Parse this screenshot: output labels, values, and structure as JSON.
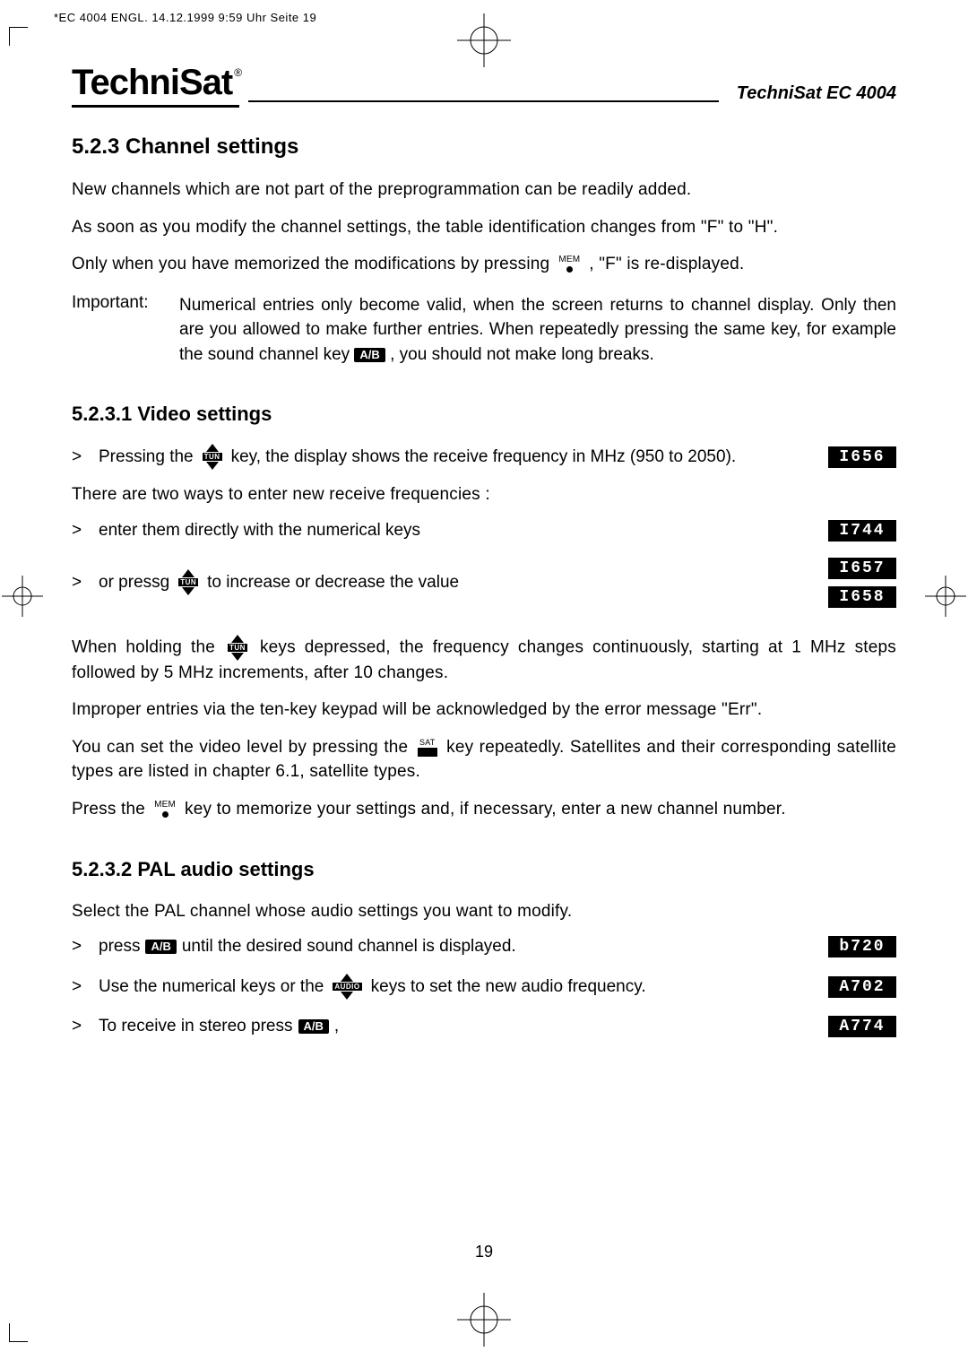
{
  "print_header": "*EC 4004 ENGL.  14.12.1999 9:59 Uhr  Seite 19",
  "logo_text": "TechniSat",
  "model": "TechniSat EC 4004",
  "sec_523_title": "5.2.3 Channel settings",
  "p_new_channels": "New channels which are not part of the preprogrammation can be readily added.",
  "p_modify": "As soon as you modify the channel settings, the table identification changes from \"F\" to \"H\".",
  "p_only_when_a": "Only when you have memorized the modifications by pressing",
  "p_only_when_b": ", \"F\" is re-displayed.",
  "important_label": "Important:",
  "important_a": "Numerical entries only become valid, when the screen returns to channel display. Only then are you allowed to make further entries. When repeatedly pressing the same key, for example the sound channel key",
  "important_b": ", you should not make long breaks.",
  "sec_5231_title": "5.2.3.1  Video settings",
  "li_pressing_a": "Pressing the",
  "li_pressing_b": "key, the display shows the receive frequency in MHz (950 to 2050).",
  "p_two_ways": "There are two ways to enter new receive frequencies :",
  "li_enter": "enter them directly with the numerical keys",
  "li_orpress_a": "or pressg",
  "li_orpress_b": "to increase or decrease the value",
  "p_holding_a": "When holding the",
  "p_holding_b": "keys depressed, the frequency changes continuously, starting at 1 MHz steps followed by 5 MHz increments, after 10 changes.",
  "p_improper": "Improper entries via the ten-key keypad will be acknowledged by the error message \"Err\".",
  "p_video_level_a": "You can set the video level by pressing the",
  "p_video_level_b": "key repeatedly. Satellites and their corresponding satellite types are listed in chapter 6.1, satellite types.",
  "p_press_mem_a": "Press the",
  "p_press_mem_b": "key to memorize your settings and, if necessary, enter a new channel number.",
  "sec_5232_title": "5.2.3.2 PAL audio settings",
  "p_select_pal": "Select the PAL channel whose audio settings you want to modify.",
  "li_press_ab_a": "press",
  "li_press_ab_b": "until the desired sound channel is displayed.",
  "li_use_num_a": "Use the numerical keys or the",
  "li_use_num_b": "keys to set the new audio frequency.",
  "li_stereo_a": "To receive in stereo press",
  "li_stereo_b": ",",
  "badge_1656": "I656",
  "badge_1744": "I744",
  "badge_1657": "I657",
  "badge_1658": "I658",
  "badge_b720": "b720",
  "badge_a702": "A702",
  "badge_a774": "A774",
  "mem_label": "MEM",
  "sat_label": "SAT",
  "tun_label": "TUN",
  "audio_label": "AUDIO",
  "ab_label": "A/B",
  "page_number": "19"
}
